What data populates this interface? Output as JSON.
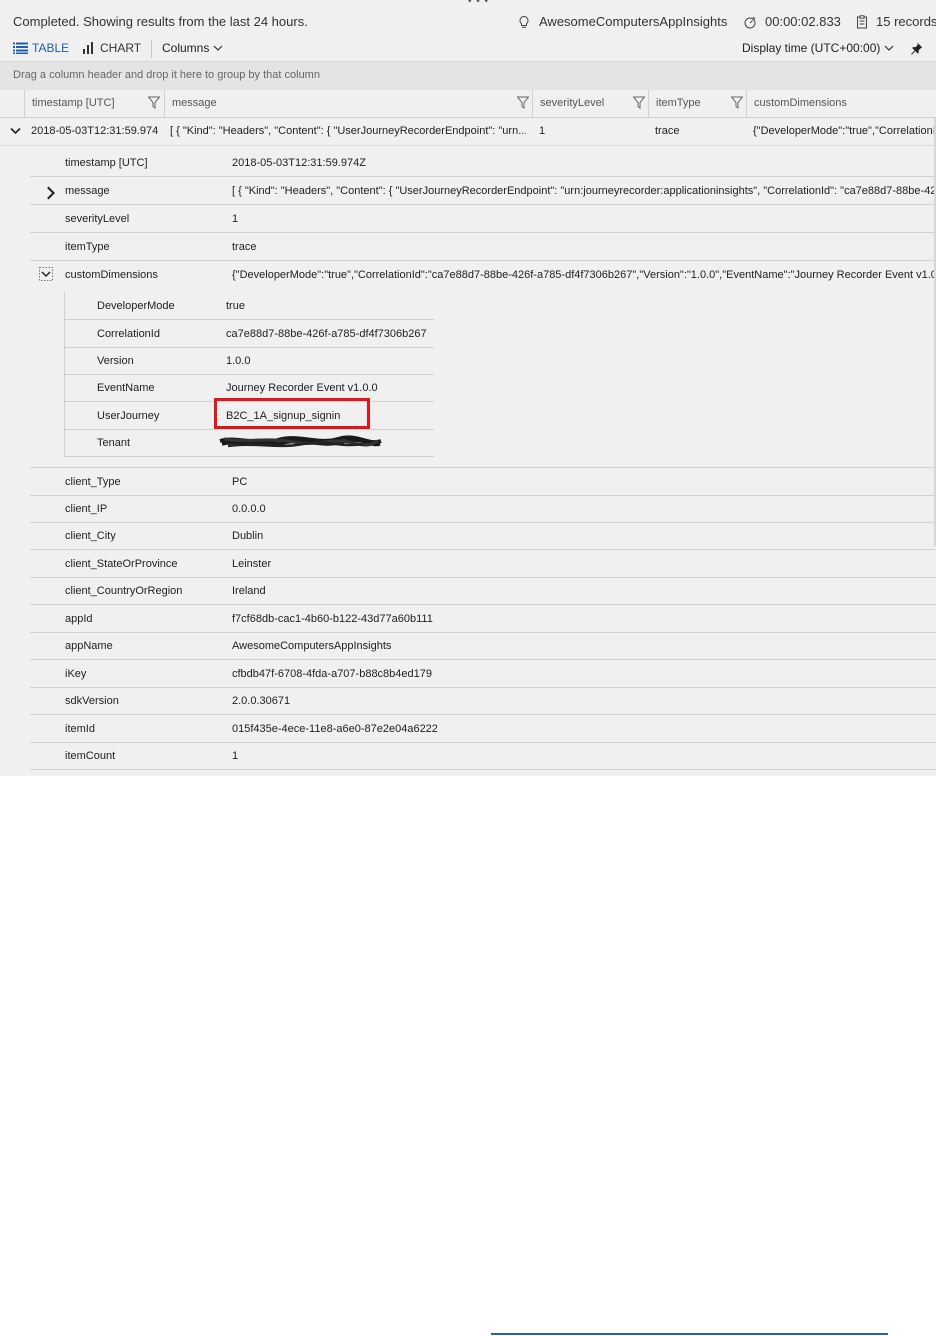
{
  "status": {
    "message": "Completed. Showing results from the last 24 hours.",
    "app_name": "AwesomeComputersAppInsights",
    "duration": "00:00:02.833",
    "records": "15 records"
  },
  "toolbar": {
    "table_label": "TABLE",
    "chart_label": "CHART",
    "columns_label": "Columns",
    "display_time": "Display time (UTC+00:00)"
  },
  "group_bar": {
    "hint": "Drag a column header and drop it here to group by that column"
  },
  "columns": [
    "timestamp [UTC]",
    "message",
    "severityLevel",
    "itemType",
    "customDimensions"
  ],
  "row": {
    "timestamp": "2018-05-03T12:31:59.974",
    "message": "[ { \"Kind\": \"Headers\", \"Content\": { \"UserJourneyRecorderEndpoint\": \"urn...",
    "severityLevel": "1",
    "itemType": "trace",
    "customDimensions": "{\"DeveloperMode\":\"true\",\"CorrelationId\""
  },
  "details_top": [
    {
      "key": "timestamp [UTC]",
      "value": "2018-05-03T12:31:59.974Z"
    },
    {
      "key": "message",
      "value": "[ { \"Kind\": \"Headers\", \"Content\": { \"UserJourneyRecorderEndpoint\": \"urn:journeyrecorder:applicationinsights\", \"CorrelationId\": \"ca7e88d7-88be-42"
    },
    {
      "key": "severityLevel",
      "value": "1"
    },
    {
      "key": "itemType",
      "value": "trace"
    },
    {
      "key": "customDimensions",
      "value": "{\"DeveloperMode\":\"true\",\"CorrelationId\":\"ca7e88d7-88be-426f-a785-df4f7306b267\",\"Version\":\"1.0.0\",\"EventName\":\"Journey Recorder Event v1.0."
    }
  ],
  "custom_dimensions": [
    {
      "key": "DeveloperMode",
      "value": "true"
    },
    {
      "key": "CorrelationId",
      "value": "ca7e88d7-88be-426f-a785-df4f7306b267"
    },
    {
      "key": "Version",
      "value": "1.0.0"
    },
    {
      "key": "EventName",
      "value": "Journey Recorder Event v1.0.0"
    },
    {
      "key": "UserJourney",
      "value": "B2C_1A_signup_signin"
    },
    {
      "key": "Tenant",
      "value": ""
    }
  ],
  "details_bottom": [
    {
      "key": "client_Type",
      "value": "PC"
    },
    {
      "key": "client_IP",
      "value": "0.0.0.0"
    },
    {
      "key": "client_City",
      "value": "Dublin"
    },
    {
      "key": "client_StateOrProvince",
      "value": "Leinster"
    },
    {
      "key": "client_CountryOrRegion",
      "value": "Ireland"
    },
    {
      "key": "appId",
      "value": "f7cf68db-cac1-4b60-b122-43d77a60b111"
    },
    {
      "key": "appName",
      "value": "AwesomeComputersAppInsights"
    },
    {
      "key": "iKey",
      "value": "cfbdb47f-6708-4fda-a707-b88c8b4ed179"
    },
    {
      "key": "sdkVersion",
      "value": "2.0.0.30671"
    },
    {
      "key": "itemId",
      "value": "015f435e-4ece-11e8-a6e0-87e2e04a6222"
    },
    {
      "key": "itemCount",
      "value": "1"
    }
  ],
  "colors": {
    "accent": "#1f5fa8",
    "highlight": "#e3151a",
    "panel": "#f0f0f0"
  }
}
